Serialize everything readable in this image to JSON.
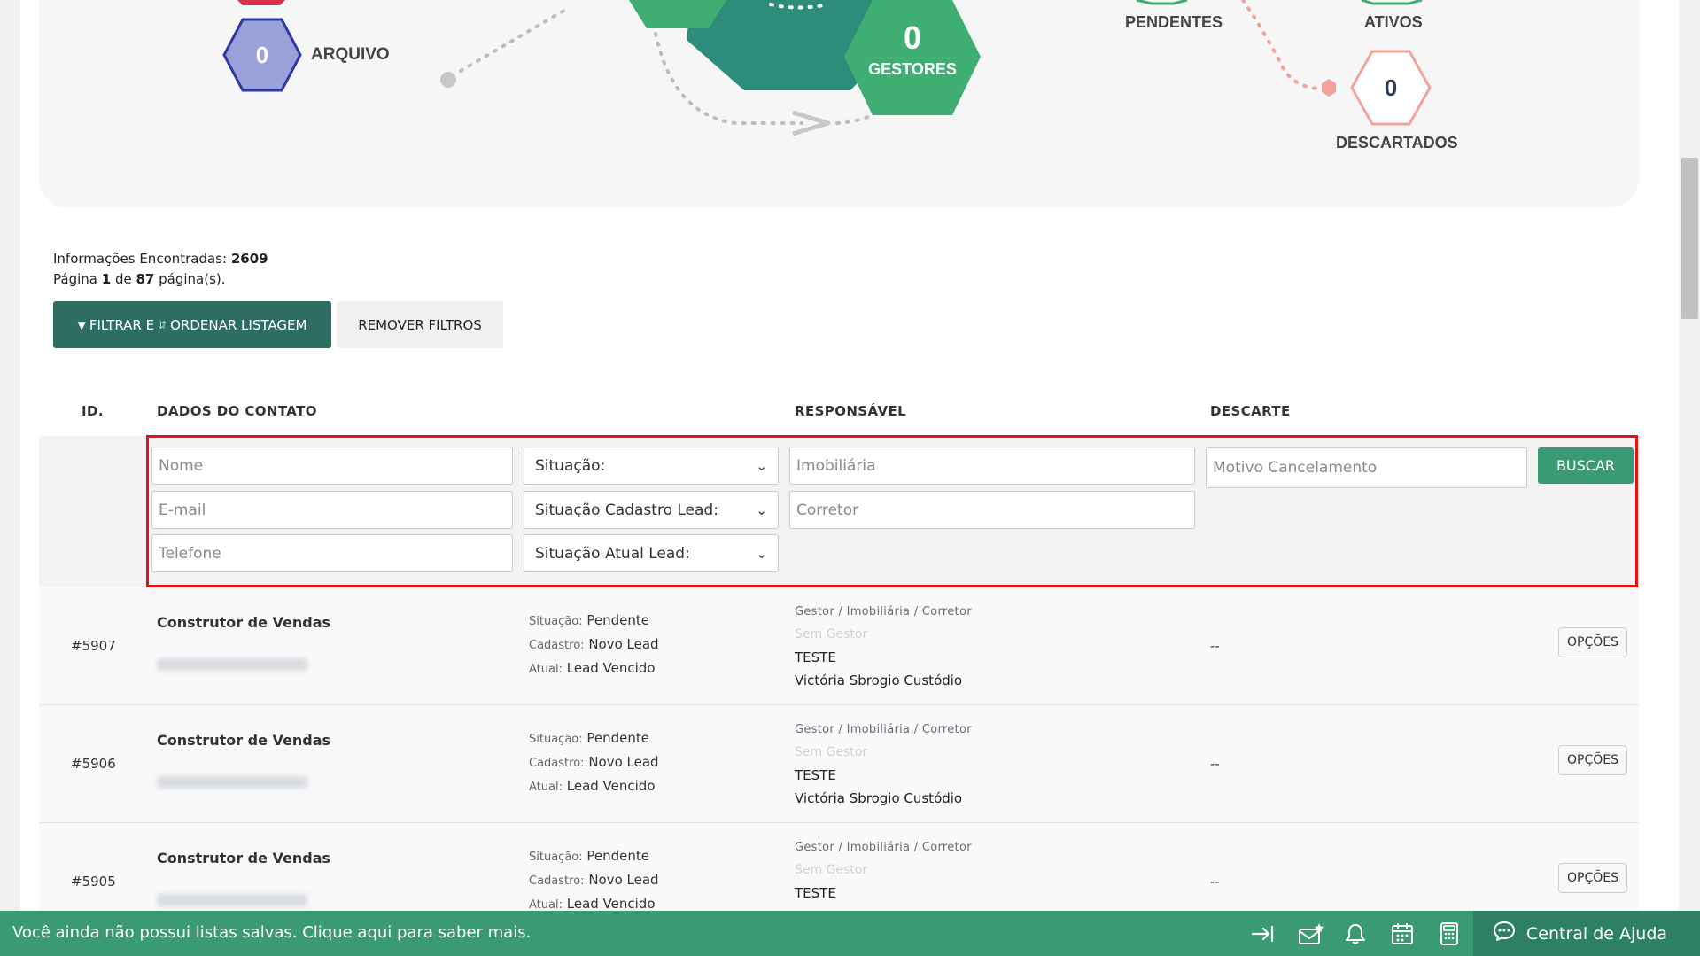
{
  "flow": {
    "arquivo_value": "0",
    "arquivo_label": "ARQUIVO",
    "gestores_value": "0",
    "gestores_label": "GESTORES",
    "pendentes_label": "PENDENTES",
    "ativos_label": "ATIVOS",
    "descartados_value": "0",
    "descartados_label": "DESCARTADOS"
  },
  "info": {
    "found_label": "Informações Encontradas:",
    "found_value": "2609",
    "page_prefix": "Página",
    "page_current": "1",
    "page_of": "de",
    "page_total": "87",
    "page_suffix": "página(s)."
  },
  "actions": {
    "filter_label_1": "FILTRAR E",
    "filter_label_2": "ORDENAR LISTAGEM",
    "remove_label": "REMOVER FILTROS"
  },
  "table": {
    "headers": {
      "id": "ID.",
      "contact": "DADOS DO CONTATO",
      "responsible": "RESPONSÁVEL",
      "discard": "DESCARTE"
    }
  },
  "filters": {
    "nome_placeholder": "Nome",
    "email_placeholder": "E-mail",
    "telefone_placeholder": "Telefone",
    "situacao": "Situação:",
    "situacao_cadastro": "Situação Cadastro Lead:",
    "situacao_atual": "Situação Atual Lead:",
    "imobiliaria_placeholder": "Imobiliária",
    "corretor_placeholder": "Corretor",
    "motivo_placeholder": "Motivo Cancelamento",
    "buscar_label": "BUSCAR"
  },
  "rows": [
    {
      "id": "#5907",
      "name": "Construtor de Vendas",
      "situacao_label": "Situação:",
      "situacao": "Pendente",
      "cadastro_label": "Cadastro:",
      "cadastro": "Novo Lead",
      "atual_label": "Atual:",
      "atual": "Lead Vencido",
      "resp_header": "Gestor / Imobiliária / Corretor",
      "gestor": "Sem Gestor",
      "imobiliaria": "TESTE",
      "corretor": "Victória Sbrogio Custódio",
      "descarte": "--",
      "options_label": "OPÇÕES"
    },
    {
      "id": "#5906",
      "name": "Construtor de Vendas",
      "situacao_label": "Situação:",
      "situacao": "Pendente",
      "cadastro_label": "Cadastro:",
      "cadastro": "Novo Lead",
      "atual_label": "Atual:",
      "atual": "Lead Vencido",
      "resp_header": "Gestor / Imobiliária / Corretor",
      "gestor": "Sem Gestor",
      "imobiliaria": "TESTE",
      "corretor": "Victória Sbrogio Custódio",
      "descarte": "--",
      "options_label": "OPÇÕES"
    },
    {
      "id": "#5905",
      "name": "Construtor de Vendas",
      "situacao_label": "Situação:",
      "situacao": "Pendente",
      "cadastro_label": "Cadastro:",
      "cadastro": "Novo Lead",
      "atual_label": "Atual:",
      "atual": "Lead Vencido",
      "resp_header": "Gestor / Imobiliária / Corretor",
      "gestor": "Sem Gestor",
      "imobiliaria": "TESTE",
      "corretor": "",
      "descarte": "--",
      "options_label": "OPÇÕES"
    }
  ],
  "bottombar": {
    "message": "Você ainda não possui listas salvas. Clique aqui para saber mais.",
    "help_label": "Central de Ajuda",
    "icons": [
      "export-icon",
      "mail-star-icon",
      "bell-icon",
      "calendar-icon",
      "calculator-icon",
      "chat-icon"
    ]
  },
  "colors": {
    "primary_dark": "#2e6e62",
    "primary": "#3a9a73",
    "hex_green": "#3fae72",
    "hex_teal": "#2e8c7a",
    "hex_purple": "#9aa1d8",
    "hex_purple_border": "#2f3aa8",
    "hex_pink": "#f2a39c",
    "highlight": "#e0131a"
  }
}
